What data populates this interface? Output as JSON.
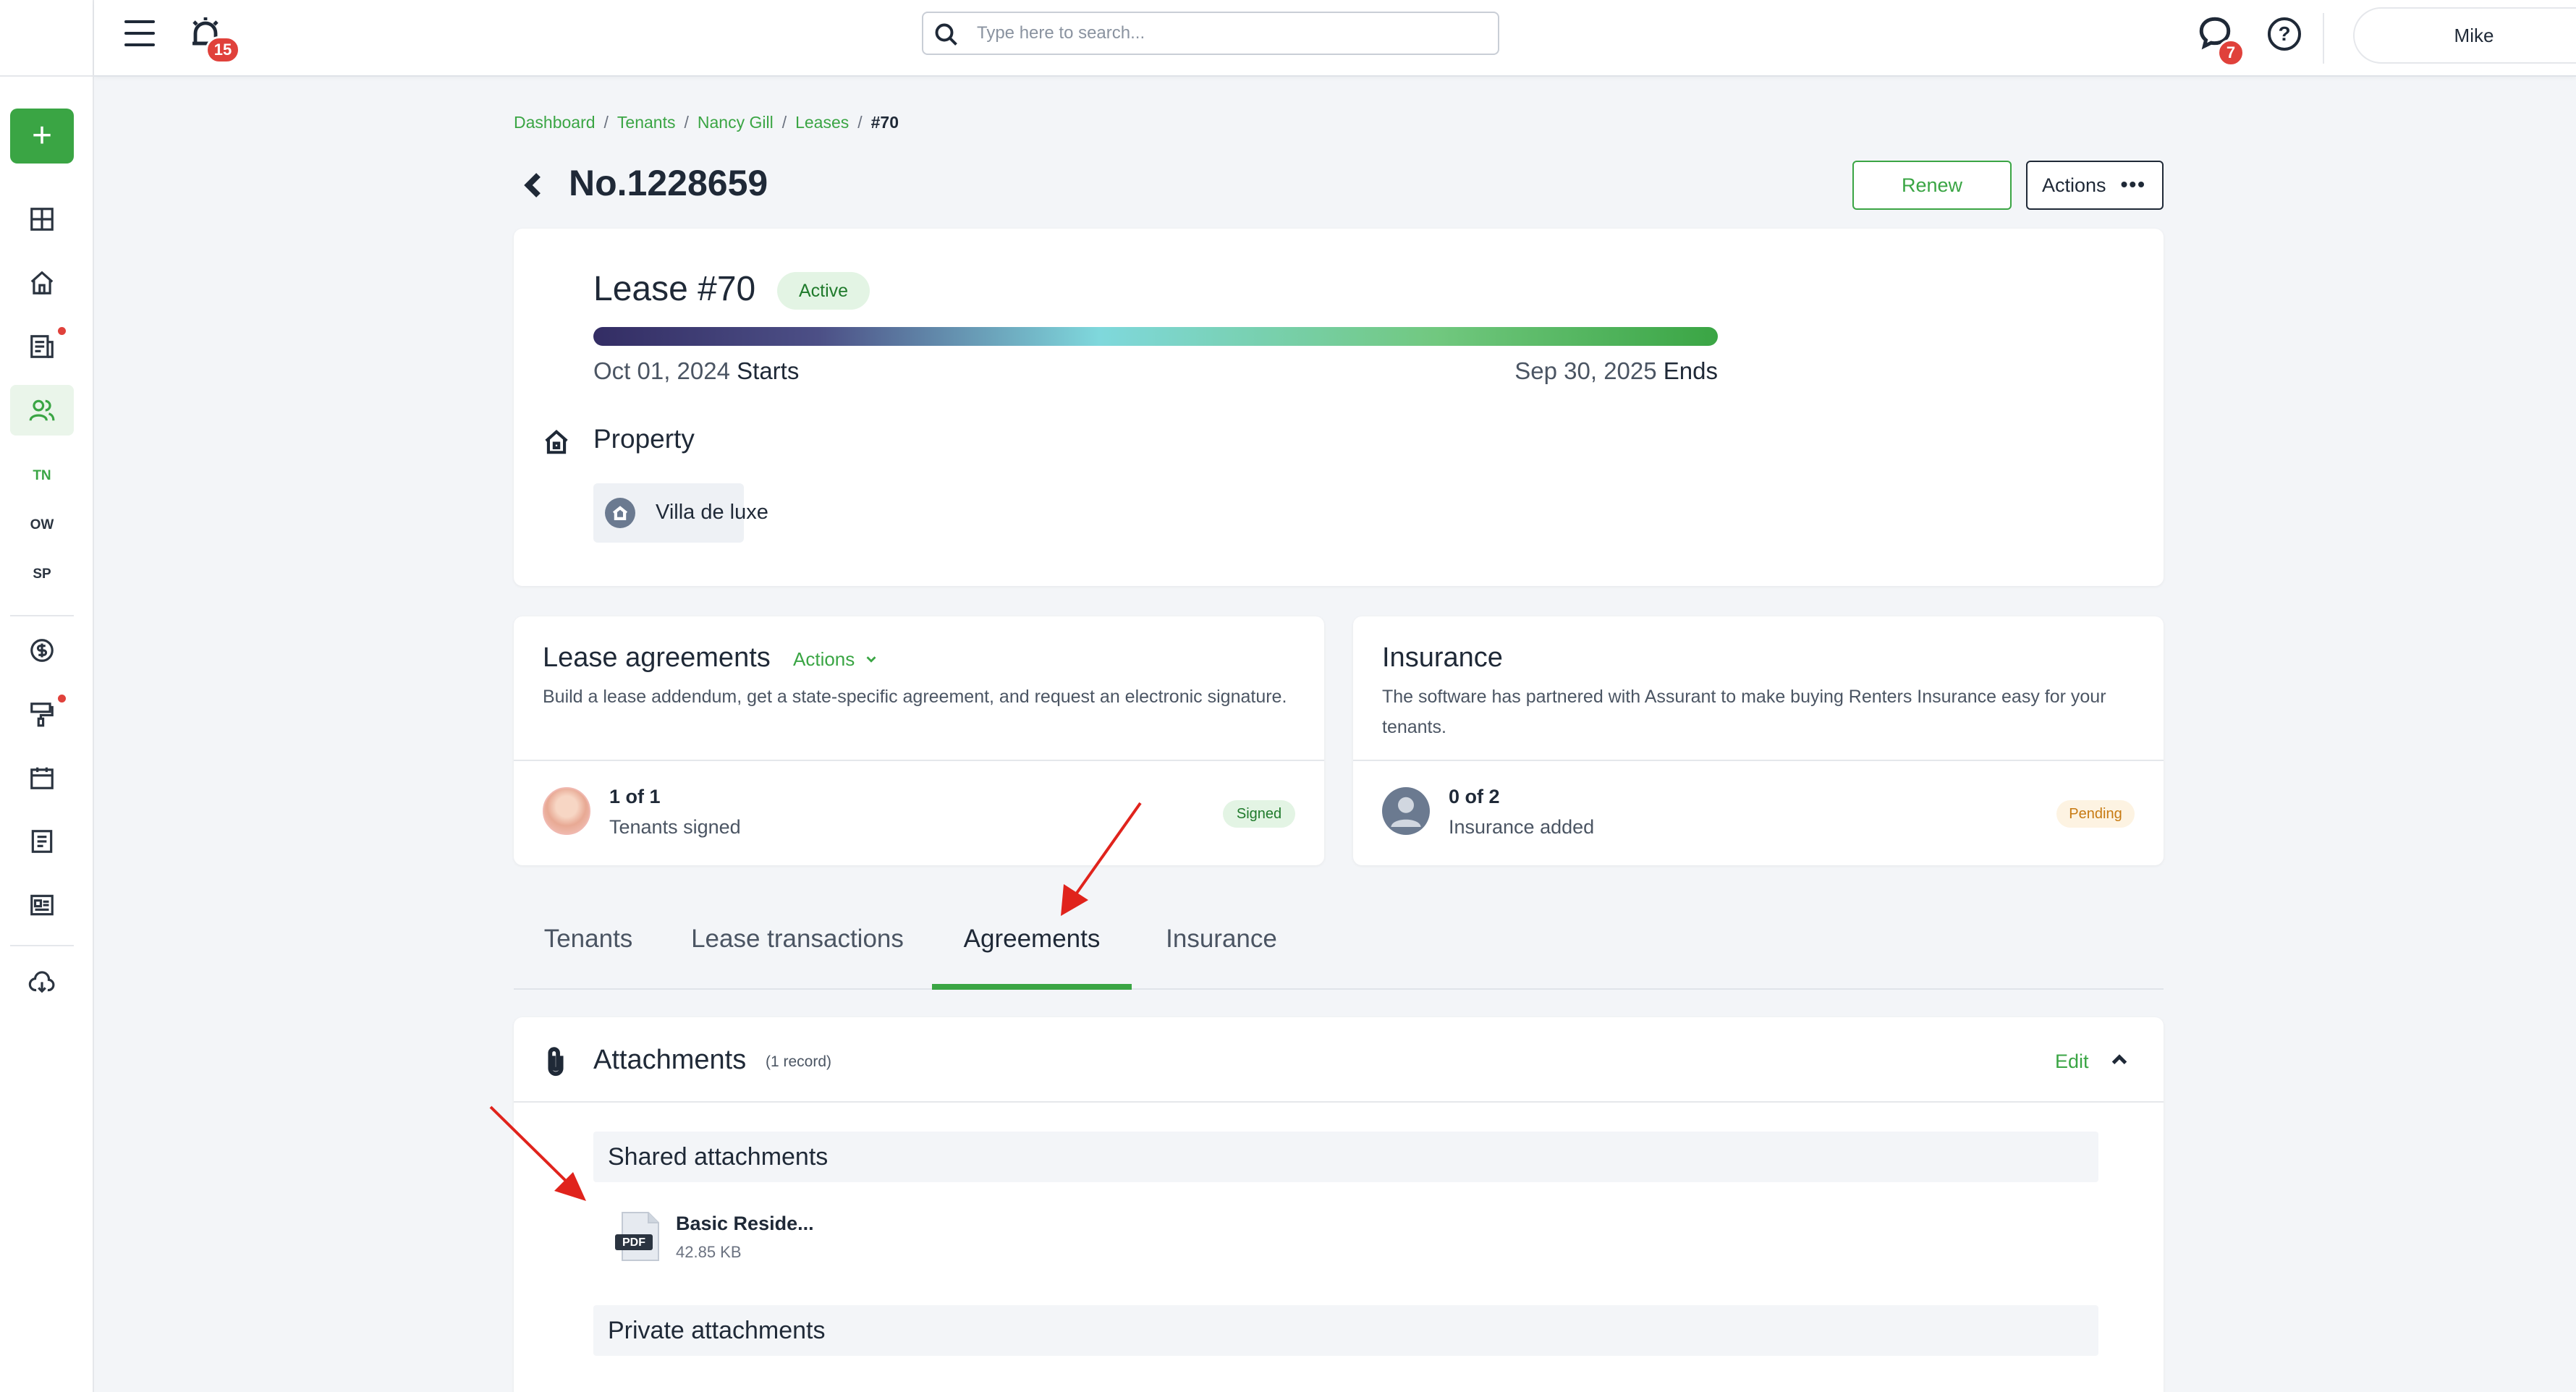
{
  "sidebar": {
    "add_label": "+",
    "items": [
      {
        "name": "dashboard-icon"
      },
      {
        "name": "properties-icon"
      },
      {
        "name": "listings-icon"
      },
      {
        "name": "people-icon"
      },
      {
        "name": "accounting-icon"
      },
      {
        "name": "maintenance-icon"
      },
      {
        "name": "calendar-icon"
      },
      {
        "name": "reports-icon"
      },
      {
        "name": "news-icon"
      },
      {
        "name": "download-icon"
      }
    ],
    "people_sub": [
      "TN",
      "OW",
      "SP"
    ]
  },
  "topbar": {
    "notifications_count": "15",
    "messages_count": "7",
    "search_placeholder": "Type here to search...",
    "help_label": "?",
    "user_name": "Mike"
  },
  "breadcrumb": [
    "Dashboard",
    "Tenants",
    "Nancy Gill",
    "Leases",
    "#70"
  ],
  "header": {
    "title": "No.1228659",
    "renew_label": "Renew",
    "actions_label": "Actions",
    "actions_dots": "•••"
  },
  "lease": {
    "title": "Lease #70",
    "status": "Active",
    "progress": 1.0,
    "start_date": "Oct 01, 2024",
    "start_label": "Starts",
    "end_date": "Sep 30, 2025",
    "end_label": "Ends",
    "property_heading": "Property",
    "property_name": "Villa de luxe"
  },
  "agreements_card": {
    "title": "Lease agreements",
    "actions_label": "Actions",
    "description": "Build a lease addendum, get a state-specific agreement, and request an electronic signature.",
    "count": "1 of 1",
    "count_label": "Tenants signed",
    "status": "Signed"
  },
  "insurance_card": {
    "title": "Insurance",
    "description": "The software has partnered with Assurant to make buying Renters Insurance easy for your tenants.",
    "count": "0 of 2",
    "count_label": "Insurance added",
    "status": "Pending"
  },
  "tabs": [
    {
      "label": "Tenants",
      "active": false
    },
    {
      "label": "Lease transactions",
      "active": false
    },
    {
      "label": "Agreements",
      "active": true
    },
    {
      "label": "Insurance",
      "active": false
    }
  ],
  "attachments": {
    "title": "Attachments",
    "count": "(1 record)",
    "edit_label": "Edit",
    "shared_heading": "Shared attachments",
    "file_name": "Basic Reside...",
    "file_size": "42.85 KB",
    "file_type": "PDF",
    "private_heading": "Private attachments"
  },
  "colors": {
    "accent": "#3aa544",
    "badge": "#e0413b",
    "annotation_arrow": "#e0231c"
  }
}
